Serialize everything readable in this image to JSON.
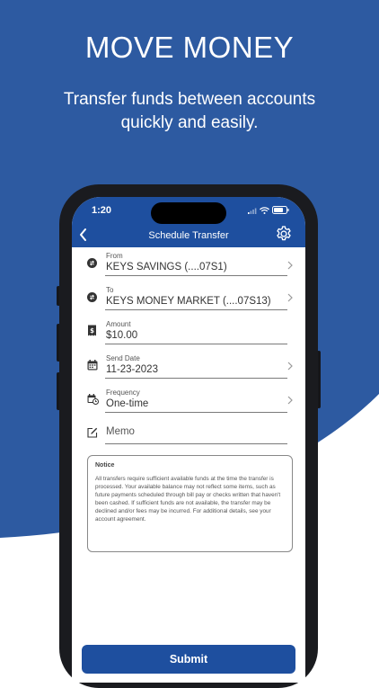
{
  "promo": {
    "headline": "MOVE MONEY",
    "subline_1": "Transfer funds between accounts",
    "subline_2": "quickly and easily.",
    "brand_color": "#2d5aa1"
  },
  "status_bar": {
    "time": "1:20"
  },
  "nav": {
    "title": "Schedule Transfer"
  },
  "form": {
    "from": {
      "label": "From",
      "value": "KEYS SAVINGS (....07S1)"
    },
    "to": {
      "label": "To",
      "value": "KEYS MONEY MARKET (....07S13)"
    },
    "amount": {
      "label": "Amount",
      "value": "$10.00"
    },
    "send_date": {
      "label": "Send Date",
      "value": "11-23-2023"
    },
    "frequency": {
      "label": "Frequency",
      "value": "One-time"
    },
    "memo": {
      "placeholder": "Memo"
    }
  },
  "notice": {
    "title": "Notice",
    "text": "All transfers require sufficient available funds at the time the transfer is processed. Your available balance may not reflect some items, such as future payments scheduled through bill pay or checks written that haven't been cashed. If sufficient funds are not available, the transfer may be declined and/or fees may be incurred. For additional details, see your account agreement."
  },
  "actions": {
    "submit_label": "Submit"
  },
  "colors": {
    "primary": "#1e4f9f",
    "background_blue": "#2d5aa1"
  }
}
